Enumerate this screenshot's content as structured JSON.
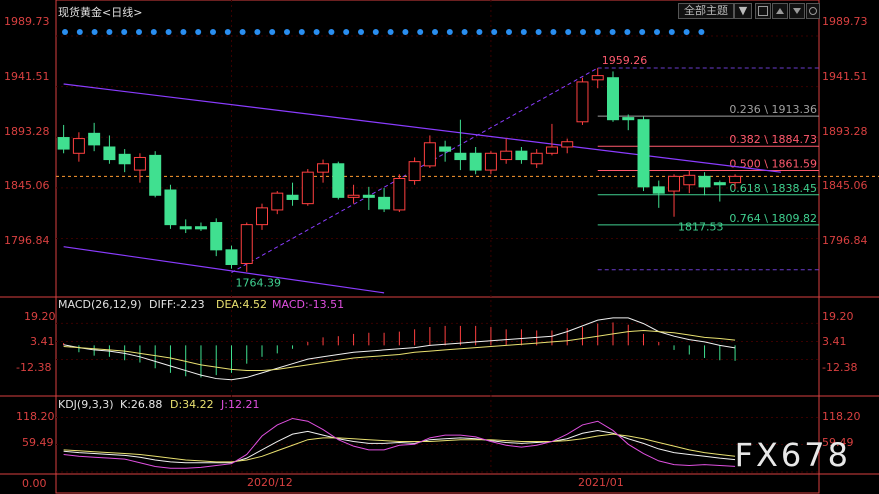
{
  "title": "现货黄金<日线>",
  "toolbar": {
    "theme_label": "全部主题",
    "theme_arrow": "▼"
  },
  "colors": {
    "up": "#ff4040",
    "down": "#40e090",
    "grid": "#3a0000",
    "axis": "#d84040",
    "trend": "#8a3cff",
    "fib_green": "#40d090",
    "fib_red": "#ff5a6e",
    "fib_gray": "#a0a0a0",
    "dotted": "#6a3ccc",
    "last_price": "#ff9a30",
    "dot": "#2a8ef0"
  },
  "chart_data": [
    {
      "type": "candlestick",
      "title": "现货黄金<日线>",
      "y_ticks": [
        "1989.73",
        "1941.51",
        "1893.28",
        "1845.06",
        "1796.84"
      ],
      "ylim": [
        1742,
        2005
      ],
      "x_ticks": [
        {
          "label": "2020/12",
          "index": 11
        },
        {
          "label": "2021/01",
          "index": 28
        }
      ],
      "candles": [
        [
          1893,
          1905,
          1878,
          1882
        ],
        [
          1878,
          1898,
          1870,
          1892
        ],
        [
          1897,
          1907,
          1880,
          1886
        ],
        [
          1884,
          1895,
          1868,
          1872
        ],
        [
          1877,
          1882,
          1860,
          1868
        ],
        [
          1862,
          1878,
          1850,
          1874
        ],
        [
          1876,
          1880,
          1836,
          1838
        ],
        [
          1843,
          1848,
          1806,
          1810
        ],
        [
          1808,
          1815,
          1802,
          1806
        ],
        [
          1808,
          1812,
          1804,
          1806
        ],
        [
          1812,
          1816,
          1780,
          1786
        ],
        [
          1786,
          1790,
          1768,
          1772
        ],
        [
          1773,
          1812,
          1765,
          1810
        ],
        [
          1810,
          1830,
          1805,
          1826
        ],
        [
          1824,
          1842,
          1820,
          1840
        ],
        [
          1838,
          1850,
          1828,
          1834
        ],
        [
          1830,
          1863,
          1828,
          1860
        ],
        [
          1860,
          1872,
          1850,
          1868
        ],
        [
          1868,
          1870,
          1834,
          1836
        ],
        [
          1836,
          1848,
          1830,
          1838
        ],
        [
          1838,
          1846,
          1824,
          1836
        ],
        [
          1836,
          1845,
          1822,
          1825
        ],
        [
          1824,
          1858,
          1822,
          1854
        ],
        [
          1852,
          1874,
          1848,
          1870
        ],
        [
          1866,
          1895,
          1864,
          1888
        ],
        [
          1884,
          1890,
          1870,
          1880
        ],
        [
          1878,
          1910,
          1862,
          1872
        ],
        [
          1878,
          1884,
          1858,
          1862
        ],
        [
          1862,
          1880,
          1858,
          1878
        ],
        [
          1872,
          1892,
          1868,
          1880
        ],
        [
          1880,
          1884,
          1868,
          1872
        ],
        [
          1868,
          1882,
          1864,
          1878
        ],
        [
          1878,
          1906,
          1876,
          1884
        ],
        [
          1884,
          1892,
          1878,
          1889
        ],
        [
          1908,
          1950,
          1905,
          1946
        ],
        [
          1948,
          1959.26,
          1940,
          1952
        ],
        [
          1950,
          1956,
          1908,
          1910
        ],
        [
          1912,
          1915,
          1900,
          1910
        ],
        [
          1910,
          1913,
          1842,
          1846
        ],
        [
          1846,
          1852,
          1826,
          1840
        ],
        [
          1842,
          1858,
          1817.53,
          1856
        ],
        [
          1848,
          1862,
          1840,
          1857
        ],
        [
          1856,
          1860,
          1838,
          1846
        ],
        [
          1850,
          1852,
          1832,
          1848
        ],
        [
          1850,
          1858,
          1844,
          1856
        ]
      ],
      "annotations": [
        {
          "text": "1959.26",
          "x": 35,
          "y": 1959.26
        },
        {
          "text": "1764.39",
          "x": 11,
          "y": 1764.39
        },
        {
          "text": "1817.53",
          "x": 40,
          "y": 1817.53
        }
      ],
      "fibonacci": [
        {
          "label": "0.236 \\ 1913.36",
          "value": 1913.36
        },
        {
          "label": "0.382 \\ 1884.73",
          "value": 1884.73
        },
        {
          "label": "0.500 \\ 1861.59",
          "value": 1861.59
        },
        {
          "label": "0.618 \\ 1838.45",
          "value": 1838.45
        },
        {
          "label": "0.764 \\ 1809.82",
          "value": 1809.82
        }
      ],
      "fib_extremes": [
        1959.26,
        1767
      ],
      "last_price": 1856,
      "channel_upper": [
        [
          0,
          1944
        ],
        [
          47,
          1860
        ]
      ],
      "channel_lower": [
        [
          0,
          1789
        ],
        [
          21,
          1745
        ]
      ],
      "trend_up": [
        [
          11,
          1764.39
        ],
        [
          35,
          1959.26
        ]
      ]
    },
    {
      "type": "bar",
      "title": "MACD(26,12,9)",
      "legend": [
        {
          "name": "DIFF",
          "text": "DIFF:-2.23",
          "value": -2.23
        },
        {
          "name": "DEA",
          "text": "DEA:4.52",
          "value": 4.52
        },
        {
          "name": "MACD",
          "text": "MACD:-13.51",
          "value": -13.51
        }
      ],
      "y_ticks": [
        "19.20",
        "3.41",
        "-12.38"
      ],
      "ylim": [
        -32,
        30
      ],
      "macd": [
        2,
        -6,
        -9,
        -10,
        -13,
        -15,
        -20,
        -24,
        -27,
        -28,
        -26,
        -24,
        -16,
        -10,
        -7,
        -3,
        3,
        7,
        8,
        10,
        11,
        11,
        12,
        14,
        16,
        17,
        17,
        17,
        16,
        14,
        14,
        13,
        13,
        15,
        16,
        19,
        20,
        18,
        10,
        3,
        -4,
        -8,
        -11,
        -13,
        -13.51
      ],
      "diff": [
        0.5,
        -2,
        -4,
        -5,
        -7,
        -10,
        -14,
        -18,
        -22,
        -26,
        -29,
        -30,
        -28,
        -24,
        -20,
        -16,
        -12,
        -10,
        -8,
        -6,
        -5,
        -4,
        -3,
        -2,
        0,
        1,
        2,
        3,
        4,
        5,
        6,
        7,
        8,
        12,
        17,
        22,
        24,
        24,
        19,
        12,
        8,
        5,
        3,
        0,
        -2.23
      ],
      "dea": [
        -1,
        -2,
        -3,
        -4,
        -5,
        -7,
        -9,
        -11,
        -14,
        -17,
        -19,
        -21,
        -22,
        -22,
        -21,
        -19,
        -17,
        -15,
        -13,
        -11,
        -10,
        -9,
        -8,
        -6,
        -5,
        -4,
        -3,
        -2,
        -1,
        0,
        1,
        2,
        3,
        4,
        6,
        8,
        10,
        12,
        13,
        12,
        11,
        9,
        7,
        6,
        4.52
      ]
    },
    {
      "type": "line",
      "title": "KDJ(9,3,3)",
      "legend": [
        {
          "name": "K",
          "text": "K:26.88",
          "value": 26.88
        },
        {
          "name": "D",
          "text": "D:34.22",
          "value": 34.22
        },
        {
          "name": "J",
          "text": "J:12.21",
          "value": 12.21
        }
      ],
      "y_ticks": [
        "118.20",
        "59.49",
        "0.00"
      ],
      "ylim": [
        0,
        130
      ],
      "k": [
        45,
        42,
        40,
        38,
        36,
        32,
        26,
        22,
        20,
        20,
        20,
        20,
        30,
        48,
        66,
        82,
        88,
        80,
        72,
        66,
        62,
        62,
        64,
        62,
        70,
        72,
        74,
        72,
        68,
        64,
        62,
        64,
        66,
        72,
        84,
        90,
        84,
        72,
        62,
        50,
        42,
        38,
        34,
        30,
        26.88
      ],
      "d": [
        48,
        46,
        44,
        42,
        40,
        38,
        34,
        30,
        26,
        24,
        22,
        22,
        26,
        34,
        46,
        58,
        70,
        74,
        74,
        72,
        70,
        68,
        66,
        66,
        66,
        68,
        70,
        70,
        70,
        68,
        66,
        66,
        66,
        68,
        72,
        78,
        82,
        78,
        72,
        64,
        56,
        48,
        42,
        38,
        34.22
      ],
      "j": [
        38,
        34,
        32,
        30,
        28,
        20,
        12,
        8,
        8,
        10,
        14,
        18,
        38,
        78,
        102,
        116,
        110,
        92,
        70,
        56,
        48,
        48,
        58,
        60,
        74,
        80,
        80,
        76,
        66,
        58,
        54,
        58,
        66,
        82,
        102,
        110,
        90,
        60,
        40,
        24,
        16,
        14,
        16,
        14,
        12.21
      ]
    }
  ],
  "watermark": "FX678"
}
